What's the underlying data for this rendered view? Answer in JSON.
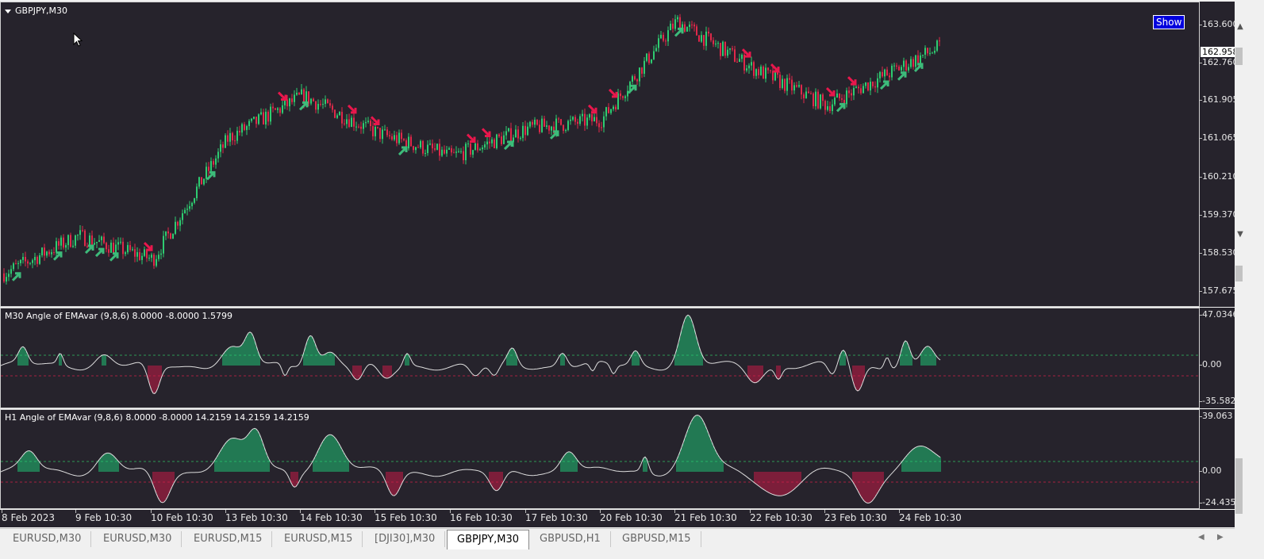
{
  "chart": {
    "symbol_label": "GBPJPY,M30",
    "show_button": "Show",
    "price_ticks": [
      "163.600",
      "162.760",
      "161.905",
      "161.065",
      "160.210",
      "159.370",
      "158.530",
      "157.675"
    ],
    "current_price": "162.958",
    "colors": {
      "background": "#26232c",
      "bull": "#2ecc71",
      "bear": "#e0294a",
      "arrow_up": "#3dbb7a",
      "arrow_down": "#e8174c",
      "line": "#e0e0e0"
    }
  },
  "indicator_m30": {
    "label": "M30  Angle of  EMAvar (9,8,6) 8.0000 -8.0000 1.5799",
    "ticks": [
      "47.0346",
      "0.00",
      "-35.5821"
    ]
  },
  "indicator_h1": {
    "label": "H1  Angle of  EMAvar (9,8,6) 8.0000 -8.0000 14.2159 14.2159 14.2159",
    "ticks": [
      "39.063",
      "0.00",
      "-24.4356"
    ]
  },
  "time_axis": [
    "8 Feb 2023",
    "9 Feb 10:30",
    "10 Feb 10:30",
    "13 Feb 10:30",
    "14 Feb 10:30",
    "15 Feb 10:30",
    "16 Feb 10:30",
    "17 Feb 10:30",
    "20 Feb 10:30",
    "21 Feb 10:30",
    "22 Feb 10:30",
    "23 Feb 10:30",
    "24 Feb 10:30"
  ],
  "tabs": [
    "EURUSD,M30",
    "EURUSD,M30",
    "EURUSD,M15",
    "EURUSD,M15",
    "[DJI30],M30",
    "GBPJPY,M30",
    "GBPUSD,H1",
    "GBPUSD,M15"
  ],
  "active_tab": "GBPJPY,M30",
  "tab_nav": {
    "left": "◀",
    "right": "▶"
  },
  "scroll_nav": {
    "up": "▲",
    "down": "▼",
    "expand": "▼"
  },
  "chart_data": {
    "type": "candlestick",
    "symbol": "GBPJPY",
    "timeframe": "M30",
    "approx_close_path": [
      {
        "t": "8 Feb 2023",
        "price": 158.1
      },
      {
        "t": "9 Feb 10:30",
        "price": 158.9
      },
      {
        "t": "10 Feb 10:30",
        "price": 158.4
      },
      {
        "t": "13 Feb 10:30",
        "price": 161.0
      },
      {
        "t": "14 Feb 10:30",
        "price": 161.9
      },
      {
        "t": "15 Feb 10:30",
        "price": 161.1
      },
      {
        "t": "16 Feb 10:30",
        "price": 160.6
      },
      {
        "t": "17 Feb 10:30",
        "price": 161.2
      },
      {
        "t": "20 Feb 10:30",
        "price": 161.4
      },
      {
        "t": "21 Feb 10:30",
        "price": 163.5
      },
      {
        "t": "22 Feb 10:30",
        "price": 162.5
      },
      {
        "t": "23 Feb 10:30",
        "price": 161.7
      },
      {
        "t": "24 Feb 10:30",
        "price": 162.958
      }
    ],
    "ylim": [
      157.4,
      163.9
    ]
  }
}
